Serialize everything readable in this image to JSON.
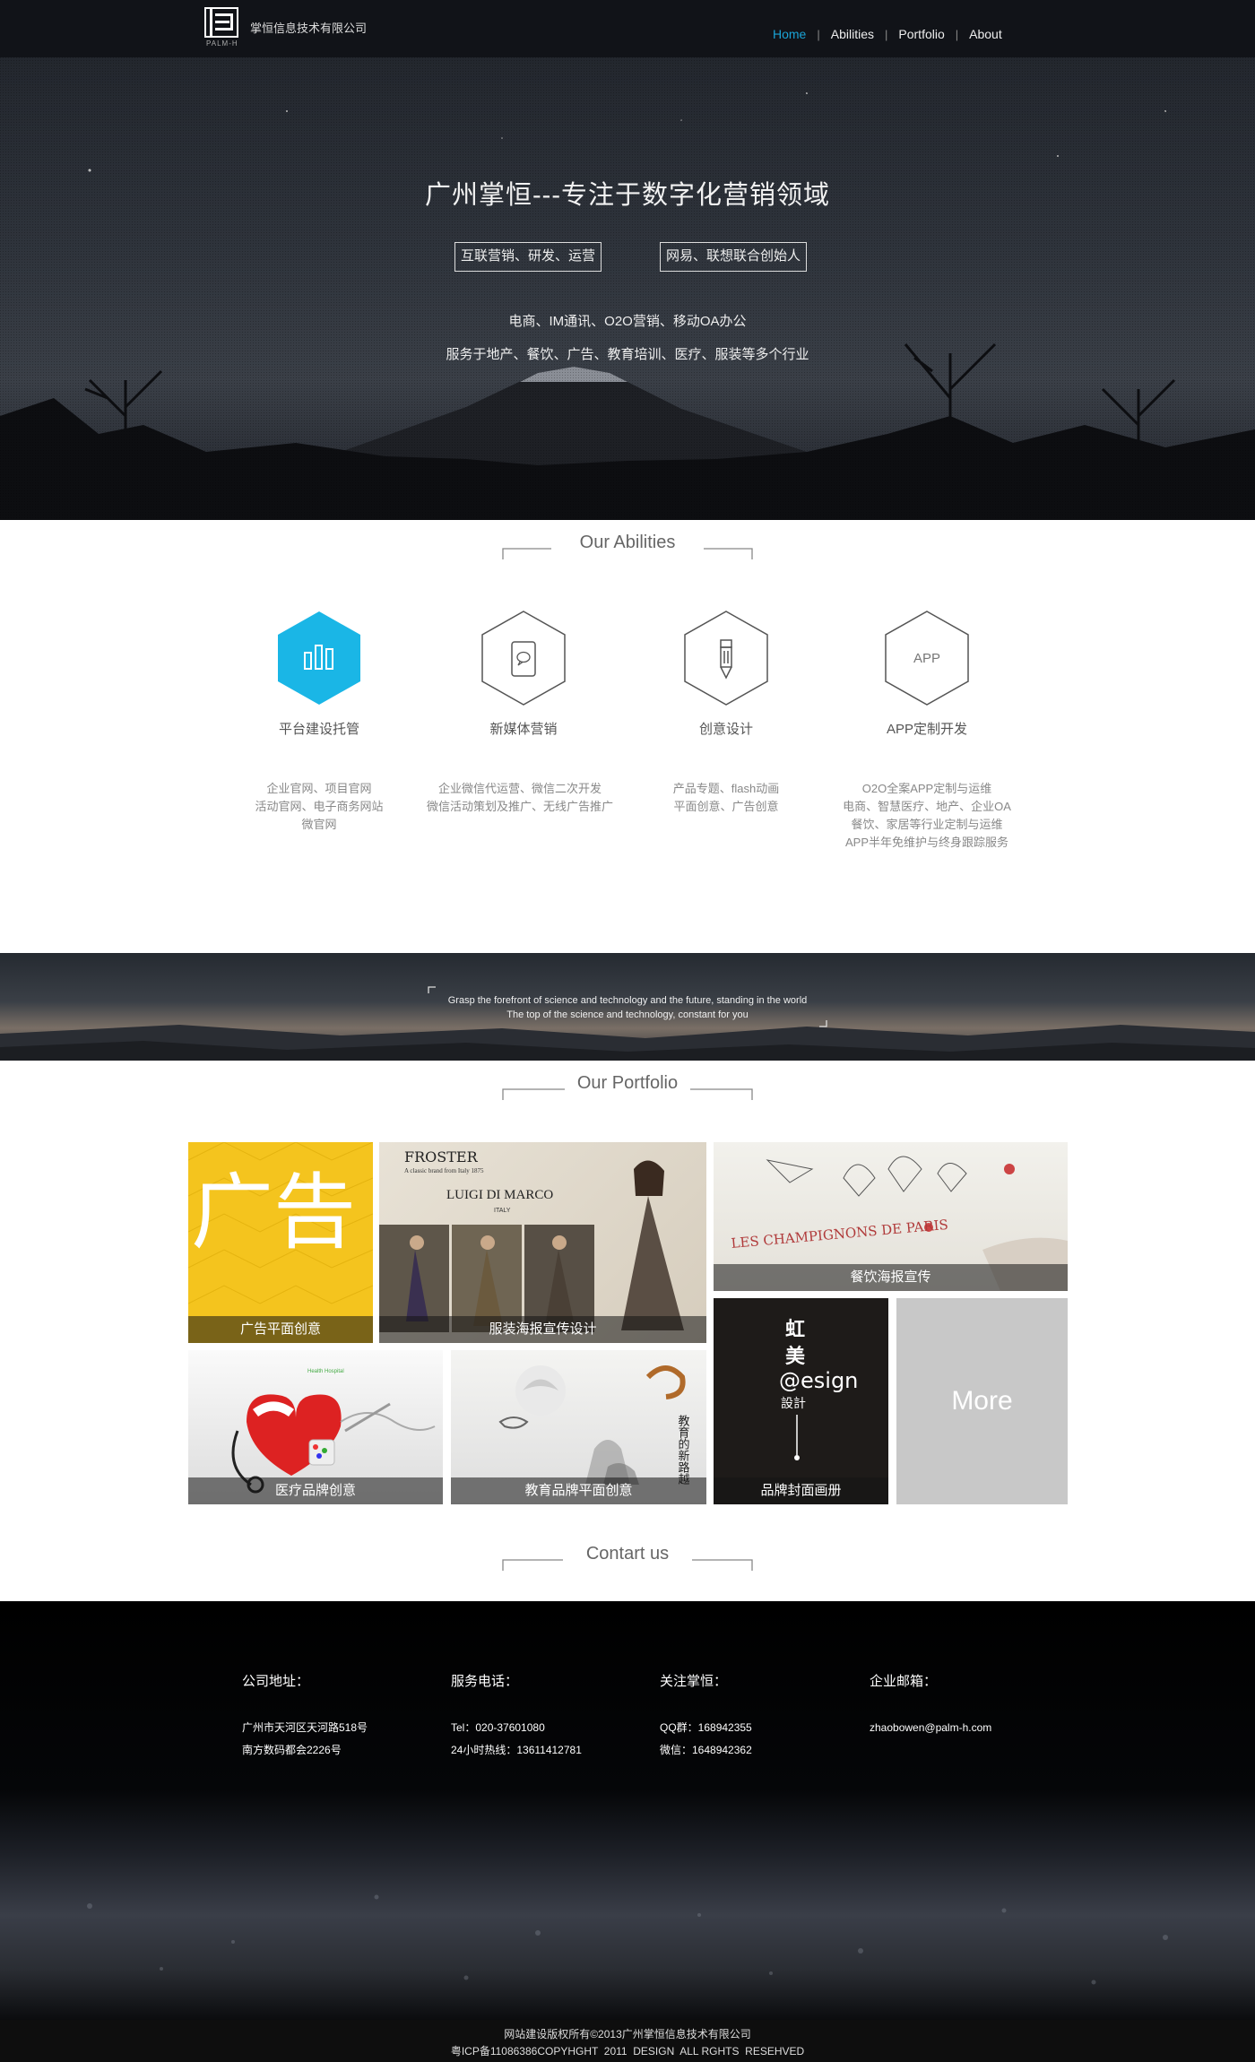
{
  "nav": {
    "company": "掌恒信息技术有限公司",
    "logo_sub": "PALM-H",
    "menu": [
      "Home",
      "Abilities",
      "Portfolio",
      "About"
    ],
    "active": "Home",
    "active_color": "#1aa3d6"
  },
  "hero": {
    "title": "广州掌恒---专注于数字化营销领域",
    "tags": [
      "互联营销、研发、运营",
      "网易、联想联合创始人"
    ],
    "line1": "电商、IM通讯、O2O营销、移动OA办公",
    "line2": "服务于地产、餐饮、广告、教育培训、医疗、服装等多个行业"
  },
  "abilities": {
    "heading": "Our Abilities",
    "accent_color": "#1ab6e6",
    "items": [
      {
        "title": "平台建设托管",
        "icon": "bar-chart-icon",
        "desc": [
          "企业官网、项目官网",
          "活动官网、电子商务网站",
          "微官网"
        ]
      },
      {
        "title": "新媒体营销",
        "icon": "mobile-chat-icon",
        "desc": [
          "企业微信代运营、微信二次开发",
          "微信活动策划及推广、无线广告推广"
        ]
      },
      {
        "title": "创意设计",
        "icon": "pen-icon",
        "desc": [
          "产品专题、flash动画",
          "平面创意、广告创意"
        ]
      },
      {
        "title": "APP定制开发",
        "icon": "app-icon",
        "icon_text": "APP",
        "desc": [
          "O2O全案APP定制与运维",
          "电商、智慧医疗、地产、企业OA",
          "餐饮、家居等行业定制与运维",
          "APP半年免维护与终身跟踪服务"
        ]
      }
    ]
  },
  "banner": {
    "line1": "Grasp the forefront of science and technology and the future, standing in the world",
    "line2": "The top of the science and technology, constant for you"
  },
  "portfolio": {
    "heading": "Our Portfolio",
    "items": [
      {
        "caption": "广告平面创意",
        "art": "广告"
      },
      {
        "caption": "服装海报宣传设计",
        "art_brand": "FROSTER",
        "art_sub": "A classic brand from Italy 1875",
        "art_name": "LUIGI DI MARCO",
        "art_place": "ITALY"
      },
      {
        "caption": "餐饮海报宣传",
        "art_text": "LES CHAMPIGNONS DE PARIS"
      },
      {
        "caption": "医疗品牌创意",
        "art_text": "Health Hospital"
      },
      {
        "caption": "教育品牌平面创意",
        "art_text": "教育的新路越"
      },
      {
        "caption": "品牌封面画册",
        "art_text1": "虹",
        "art_text2": "美",
        "art_text3": "@esign",
        "art_text4": "設計"
      },
      {
        "caption": "More"
      }
    ]
  },
  "contact": {
    "heading": "Contart us",
    "columns": [
      {
        "title": "公司地址：",
        "lines": [
          "广州市天河区天河路518号",
          "南方数码都会2226号"
        ]
      },
      {
        "title": "服务电话：",
        "lines": [
          "Tel：020-37601080",
          "24小时热线：13611412781"
        ]
      },
      {
        "title": "关注掌恒：",
        "lines": [
          "QQ群：168942355",
          "微信：1648942362"
        ]
      },
      {
        "title": "企业邮箱：",
        "lines": [
          "zhaobowen@palm-h.com"
        ]
      }
    ]
  },
  "copyright": {
    "line1": "网站建设版权所有©2013广州掌恒信息技术有限公司",
    "line2": "粤ICP备11086386COPYHGHT  2011  DESIGN  ALL RGHTS  RESEHVED"
  }
}
